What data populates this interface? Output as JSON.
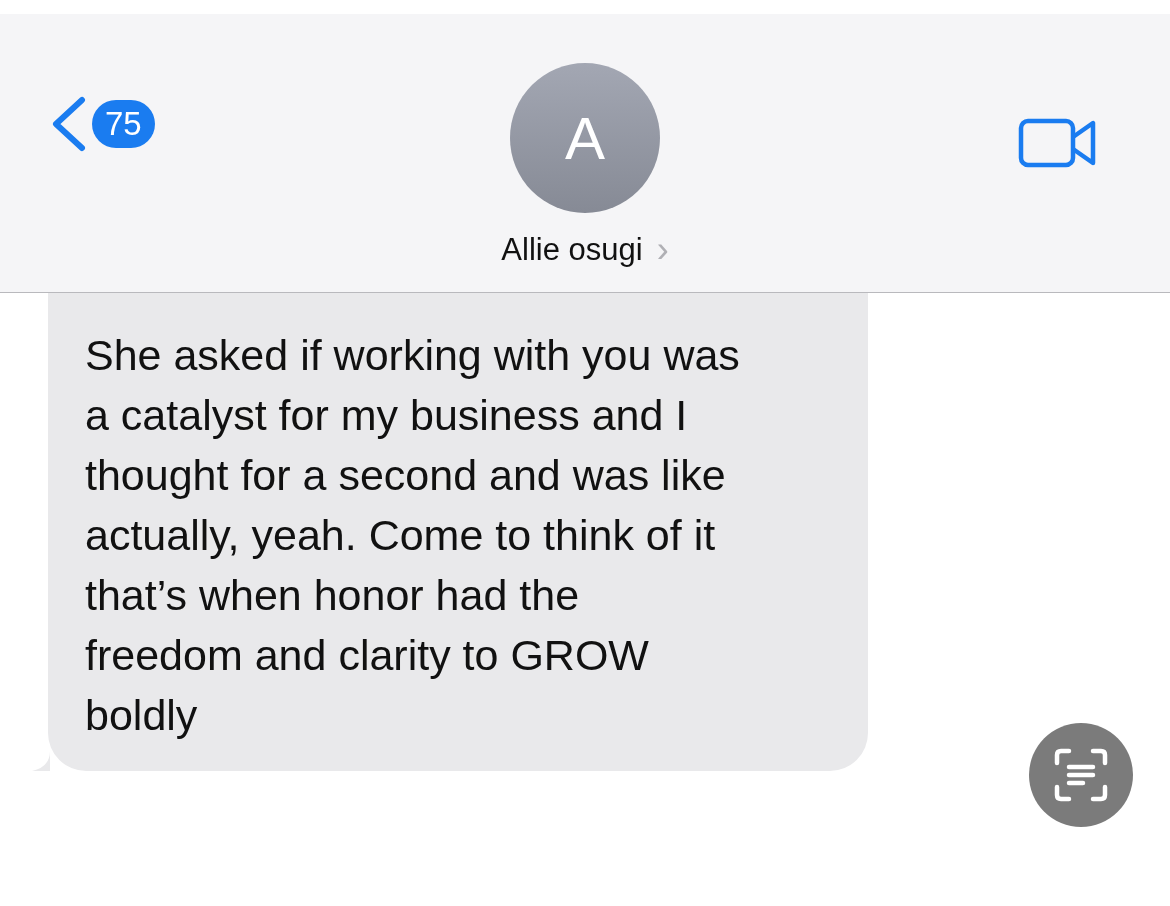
{
  "header": {
    "back_count": "75",
    "avatar_initial": "A",
    "contact_name": "Allie osugi",
    "name_chevron": "›"
  },
  "messages": [
    {
      "kind": "received",
      "text": "She asked if working with you was\na catalyst for my business and I\nthought for a second and was like\nactually, yeah. Come to think of it\nthat’s when honor had the\nfreedom and clarity to GROW\nboldly"
    }
  ]
}
